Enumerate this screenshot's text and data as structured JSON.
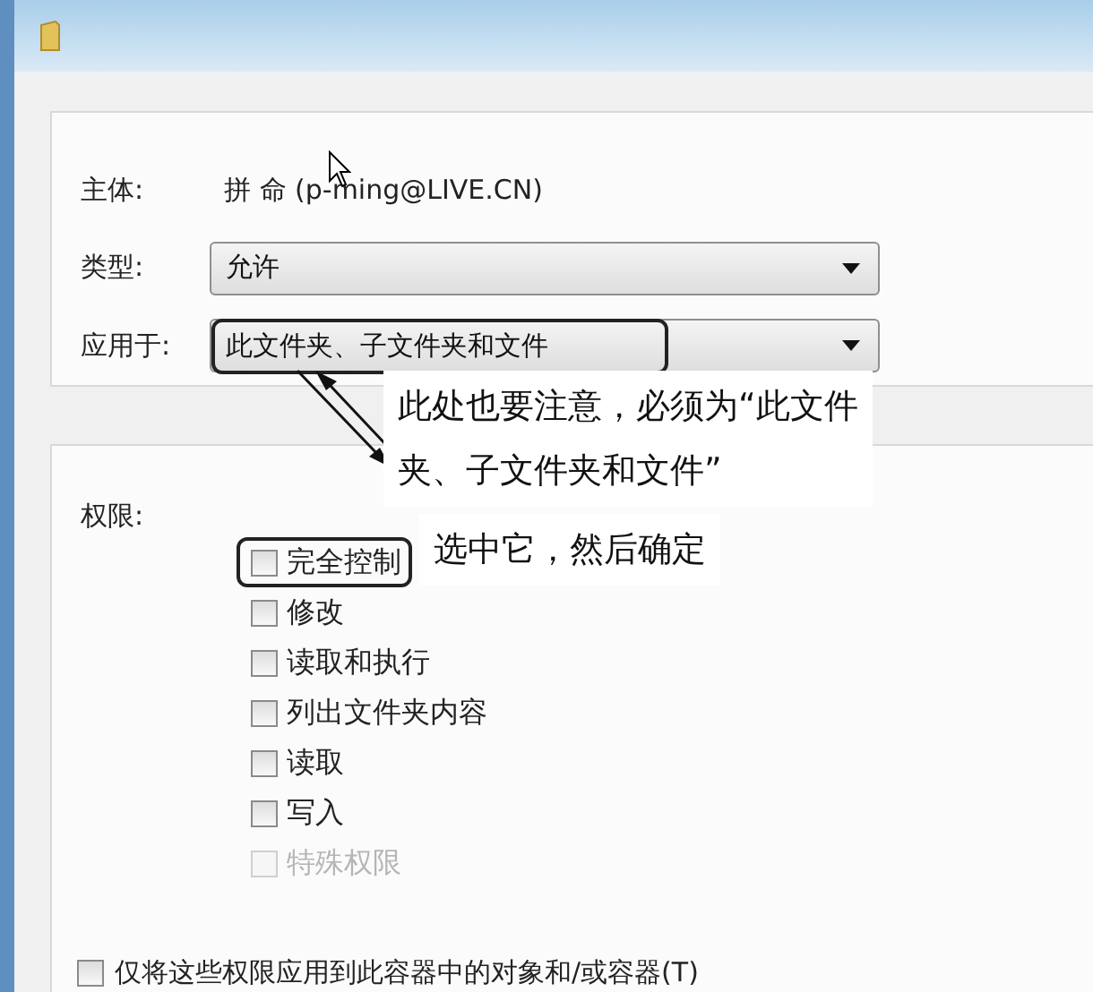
{
  "principal": {
    "label": "主体:",
    "value": "拼 命 (p-ming@LIVE.CN)"
  },
  "type": {
    "label": "类型:",
    "value": "允许"
  },
  "apply_to": {
    "label": "应用于:",
    "value": "此文件夹、子文件夹和文件",
    "highlighted": true
  },
  "permissions": {
    "label": "权限:",
    "items": [
      {
        "label": "完全控制",
        "checked": false,
        "disabled": false,
        "highlighted": true
      },
      {
        "label": "修改",
        "checked": false,
        "disabled": false,
        "highlighted": false
      },
      {
        "label": "读取和执行",
        "checked": false,
        "disabled": false,
        "highlighted": false
      },
      {
        "label": "列出文件夹内容",
        "checked": false,
        "disabled": false,
        "highlighted": false
      },
      {
        "label": "读取",
        "checked": false,
        "disabled": false,
        "highlighted": false
      },
      {
        "label": "写入",
        "checked": false,
        "disabled": false,
        "highlighted": false
      },
      {
        "label": "特殊权限",
        "checked": false,
        "disabled": true,
        "highlighted": false
      }
    ]
  },
  "apply_only": {
    "label": "仅将这些权限应用到此容器中的对象和/或容器(T)",
    "checked": false
  },
  "annotations": [
    {
      "lines": [
        "此处也要注意，必须为“此文件",
        "夹、子文件夹和文件”"
      ]
    },
    {
      "lines": [
        "选中它，然后确定"
      ]
    }
  ]
}
